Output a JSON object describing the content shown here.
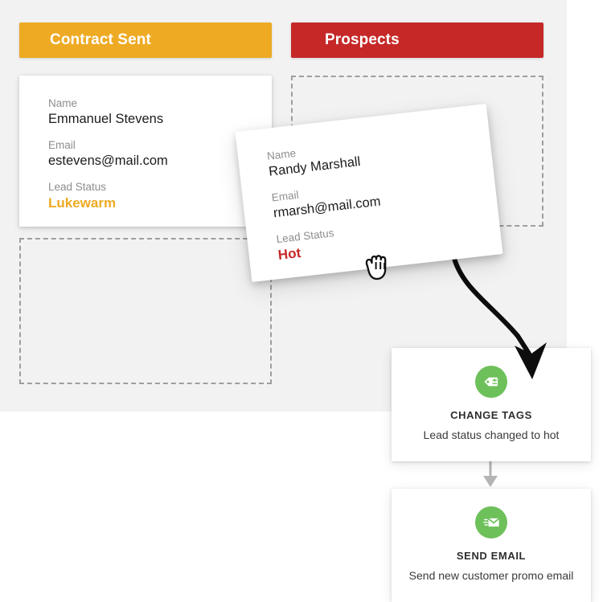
{
  "board": {
    "columns": [
      {
        "id": "contract-sent",
        "title": "Contract Sent",
        "color": "#eeaa22",
        "cards": [
          {
            "name_label": "Name",
            "name_value": "Emmanuel Stevens",
            "email_label": "Email",
            "email_value": "estevens@mail.com",
            "status_label": "Lead Status",
            "status_value": "Lukewarm",
            "status_color": "#eeaa22"
          }
        ],
        "has_drop_zone": true
      },
      {
        "id": "prospects",
        "title": "Prospects",
        "color": "#c62828",
        "cards": [],
        "has_drop_zone": true
      }
    ]
  },
  "dragged_card": {
    "name_label": "Name",
    "name_value": "Randy Marshall",
    "email_label": "Email",
    "email_value": "rmarsh@mail.com",
    "status_label": "Lead Status",
    "status_value": "Hot",
    "status_color": "#c62828",
    "cursor_icon": "grabbing-hand-icon"
  },
  "workflow": {
    "accent_color": "#6ec05a",
    "nodes": [
      {
        "id": "change-tags",
        "icon": "tag-plus-minus-icon",
        "title": "CHANGE TAGS",
        "description": "Lead status changed to hot"
      },
      {
        "id": "send-email",
        "icon": "send-email-icon",
        "title": "SEND EMAIL",
        "description": "Send new customer promo email"
      }
    ],
    "connectors": [
      {
        "id": "drag-to-change-tags",
        "style": "curved-arrow",
        "color": "#0d0d0d"
      },
      {
        "id": "change-tags-to-send-email",
        "style": "straight-arrow",
        "color": "#b5b5b5"
      }
    ]
  }
}
